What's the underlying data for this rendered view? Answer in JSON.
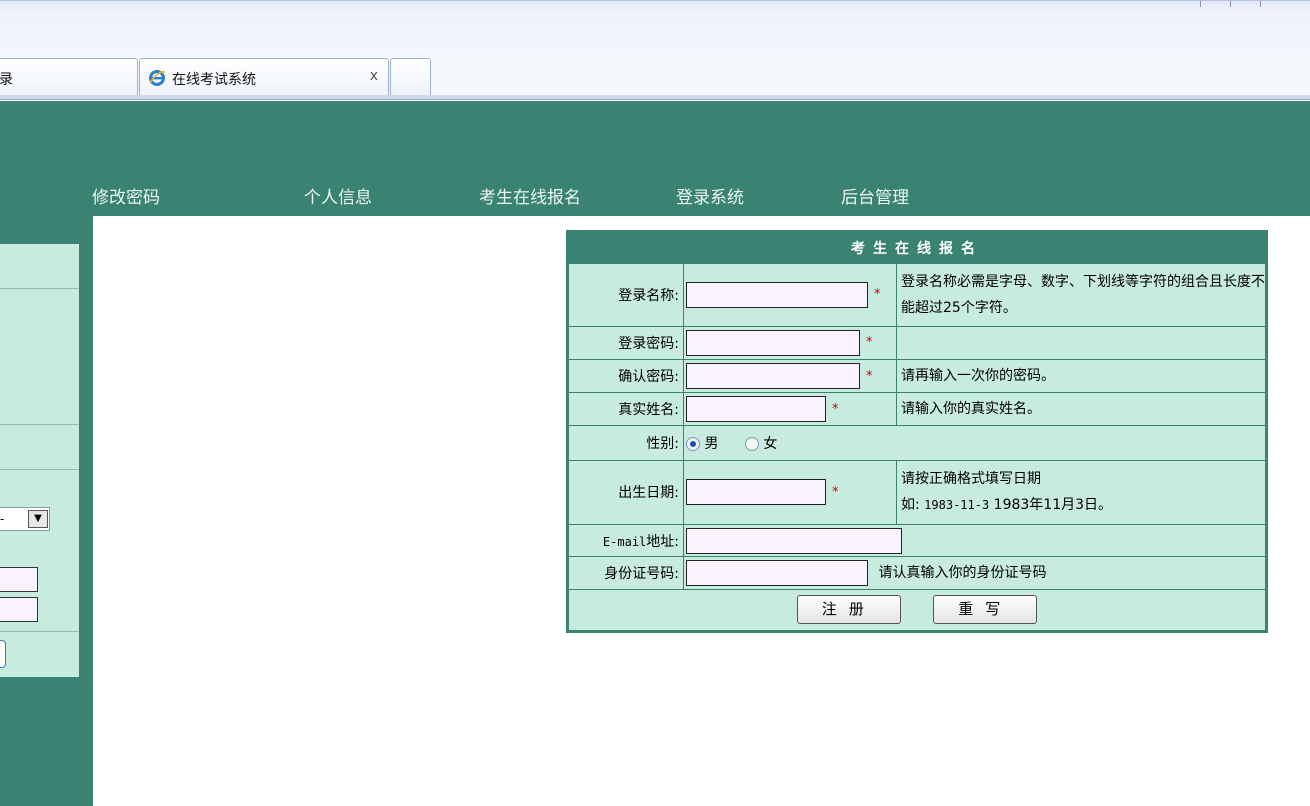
{
  "browser": {
    "tabs": [
      {
        "label": "录"
      },
      {
        "label": "在线考试系统",
        "close": "x"
      }
    ]
  },
  "nav": {
    "items": [
      "修改密码",
      "个人信息",
      "考生在线报名",
      "登录系统",
      "后台管理"
    ]
  },
  "sidebar": {
    "select_value": "-"
  },
  "form": {
    "title": "考生在线报名",
    "required_mark": "*",
    "fields": {
      "login_name": {
        "label": "登录名称:",
        "hint": "登录名称必需是字母、数字、下划线等字符的组合且长度不能超过25个字符。"
      },
      "password": {
        "label": "登录密码:"
      },
      "confirm": {
        "label": "确认密码:",
        "hint": "请再输入一次你的密码。"
      },
      "real_name": {
        "label": "真实姓名:",
        "hint": "请输入你的真实姓名。"
      },
      "gender": {
        "label": "性别:",
        "options": [
          "男",
          "女"
        ],
        "selected": "男"
      },
      "birth": {
        "label": "出生日期:",
        "hint_line1": "请按正确格式填写日期",
        "hint_line2_prefix": "如:",
        "hint_line2_code": "1983-11-3",
        "hint_line2_suffix": "1983年11月3日。"
      },
      "email": {
        "label_code": "E-mail",
        "label_rest": "地址:"
      },
      "id_card": {
        "label": "身份证号码:",
        "hint": "请认真输入你的身份证号码"
      }
    },
    "buttons": {
      "register": "注册",
      "reset": "重写"
    }
  }
}
